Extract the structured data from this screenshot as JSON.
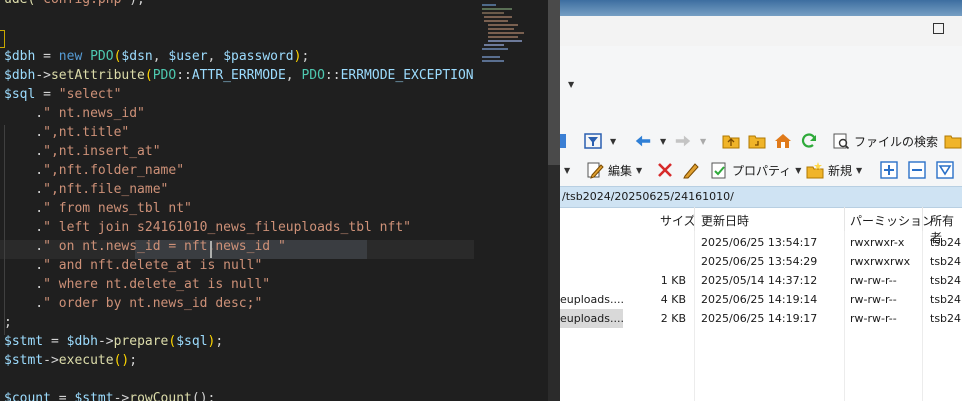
{
  "editor": {
    "lines": [
      {
        "segments": [
          {
            "t": "ude(",
            "c": "fn"
          },
          {
            "t": "'config.php'",
            "c": "str"
          },
          {
            "t": ");",
            "c": "op"
          }
        ]
      },
      {
        "segments": []
      },
      {
        "segments": []
      },
      {
        "segments": [
          {
            "t": "$dbh",
            "c": "var"
          },
          {
            "t": " = ",
            "c": "op"
          },
          {
            "t": "new",
            "c": "kw"
          },
          {
            "t": " ",
            "c": "op"
          },
          {
            "t": "PDO",
            "c": "cls"
          },
          {
            "t": "(",
            "c": "brk"
          },
          {
            "t": "$dsn",
            "c": "var"
          },
          {
            "t": ", ",
            "c": "op"
          },
          {
            "t": "$user",
            "c": "var"
          },
          {
            "t": ", ",
            "c": "op"
          },
          {
            "t": "$password",
            "c": "var"
          },
          {
            "t": ")",
            "c": "brk"
          },
          {
            "t": ";",
            "c": "op"
          }
        ]
      },
      {
        "segments": [
          {
            "t": "$dbh",
            "c": "var"
          },
          {
            "t": "->",
            "c": "op"
          },
          {
            "t": "setAttribute",
            "c": "fn"
          },
          {
            "t": "(",
            "c": "brk"
          },
          {
            "t": "PDO",
            "c": "cls"
          },
          {
            "t": "::",
            "c": "op"
          },
          {
            "t": "ATTR_ERRMODE",
            "c": "var"
          },
          {
            "t": ", ",
            "c": "op"
          },
          {
            "t": "PDO",
            "c": "cls"
          },
          {
            "t": "::",
            "c": "op"
          },
          {
            "t": "ERRMODE_EXCEPTION",
            "c": "var"
          },
          {
            "t": ")",
            "c": "brk"
          }
        ]
      },
      {
        "segments": [
          {
            "t": "$sql",
            "c": "var"
          },
          {
            "t": " = ",
            "c": "op"
          },
          {
            "t": "\"select\"",
            "c": "str"
          }
        ]
      },
      {
        "segments": [
          {
            "t": "    .",
            "c": "op"
          },
          {
            "t": "\" nt.news_id\"",
            "c": "str"
          }
        ]
      },
      {
        "segments": [
          {
            "t": "    .",
            "c": "op"
          },
          {
            "t": "\",nt.title\"",
            "c": "str"
          }
        ]
      },
      {
        "segments": [
          {
            "t": "    .",
            "c": "op"
          },
          {
            "t": "\",nt.insert_at\"",
            "c": "str"
          }
        ]
      },
      {
        "segments": [
          {
            "t": "    .",
            "c": "op"
          },
          {
            "t": "\",nft.folder_name\"",
            "c": "str"
          }
        ]
      },
      {
        "segments": [
          {
            "t": "    .",
            "c": "op"
          },
          {
            "t": "\",nft.file_name\"",
            "c": "str"
          }
        ]
      },
      {
        "segments": [
          {
            "t": "    .",
            "c": "op"
          },
          {
            "t": "\" from news_tbl nt\"",
            "c": "str"
          }
        ]
      },
      {
        "segments": [
          {
            "t": "    .",
            "c": "op"
          },
          {
            "t": "\" left join s24161010_news_fileuploads_tbl nft\"",
            "c": "str"
          }
        ]
      },
      {
        "segments": [
          {
            "t": "    .",
            "c": "op"
          },
          {
            "t": "\" on nt.news_id = nft.news_id \"",
            "c": "str"
          }
        ]
      },
      {
        "segments": [
          {
            "t": "    .",
            "c": "op"
          },
          {
            "t": "\" and nft.delete_at is null\"",
            "c": "str"
          }
        ]
      },
      {
        "segments": [
          {
            "t": "    .",
            "c": "op"
          },
          {
            "t": "\" where nt.delete_at is null\"",
            "c": "str"
          }
        ]
      },
      {
        "segments": [
          {
            "t": "    .",
            "c": "op"
          },
          {
            "t": "\" order by nt.news_id desc;\"",
            "c": "str"
          }
        ]
      },
      {
        "segments": [
          {
            "t": ";",
            "c": "op"
          }
        ]
      },
      {
        "segments": [
          {
            "t": "$stmt",
            "c": "var"
          },
          {
            "t": " = ",
            "c": "op"
          },
          {
            "t": "$dbh",
            "c": "var"
          },
          {
            "t": "->",
            "c": "op"
          },
          {
            "t": "prepare",
            "c": "fn"
          },
          {
            "t": "(",
            "c": "brk"
          },
          {
            "t": "$sql",
            "c": "var"
          },
          {
            "t": ")",
            "c": "brk"
          },
          {
            "t": ";",
            "c": "op"
          }
        ]
      },
      {
        "segments": [
          {
            "t": "$stmt",
            "c": "var"
          },
          {
            "t": "->",
            "c": "op"
          },
          {
            "t": "execute",
            "c": "fn"
          },
          {
            "t": "()",
            "c": "brk"
          },
          {
            "t": ";",
            "c": "op"
          }
        ]
      },
      {
        "segments": []
      },
      {
        "segments": [
          {
            "t": "$count",
            "c": "var"
          },
          {
            "t": " = ",
            "c": "op"
          },
          {
            "t": "$stmt",
            "c": "var"
          },
          {
            "t": "->",
            "c": "op"
          },
          {
            "t": "rowCount",
            "c": "fn"
          },
          {
            "t": "();",
            "c": "op"
          }
        ]
      }
    ]
  },
  "file_manager": {
    "toolbar1": {
      "search_label": "ファイルの検索"
    },
    "toolbar2": {
      "edit_label": "編集",
      "properties_label": "プロパティ",
      "new_label": "新規"
    },
    "path": "/tsb2024/20250625/24161010/",
    "columns": {
      "size": "サイズ",
      "modified": "更新日時",
      "permission": "パーミッション",
      "owner": "所有者"
    },
    "rows": [
      {
        "name": "",
        "size": "",
        "modified": "2025/06/25 13:54:17",
        "permission": "rwxrwxr-x",
        "owner": "tsb24"
      },
      {
        "name": "",
        "size": "",
        "modified": "2025/06/25 13:54:29",
        "permission": "rwxrwxrwx",
        "owner": "tsb24"
      },
      {
        "name": "",
        "size": "1 KB",
        "modified": "2025/05/14 14:37:12",
        "permission": "rw-rw-r--",
        "owner": "tsb24"
      },
      {
        "name": "euploads....",
        "size": "4 KB",
        "modified": "2025/06/25 14:19:14",
        "permission": "rw-rw-r--",
        "owner": "tsb24"
      },
      {
        "name": "euploads....",
        "size": "2 KB",
        "modified": "2025/06/25 14:19:17",
        "permission": "rw-rw-r--",
        "owner": "tsb24"
      }
    ]
  },
  "colors": {
    "editor_bg": "#1f1f1f",
    "keyword": "#569cd6",
    "variable": "#9cdcfe",
    "string": "#ce9178",
    "function": "#dcdcaa",
    "class": "#4ec9b0"
  }
}
